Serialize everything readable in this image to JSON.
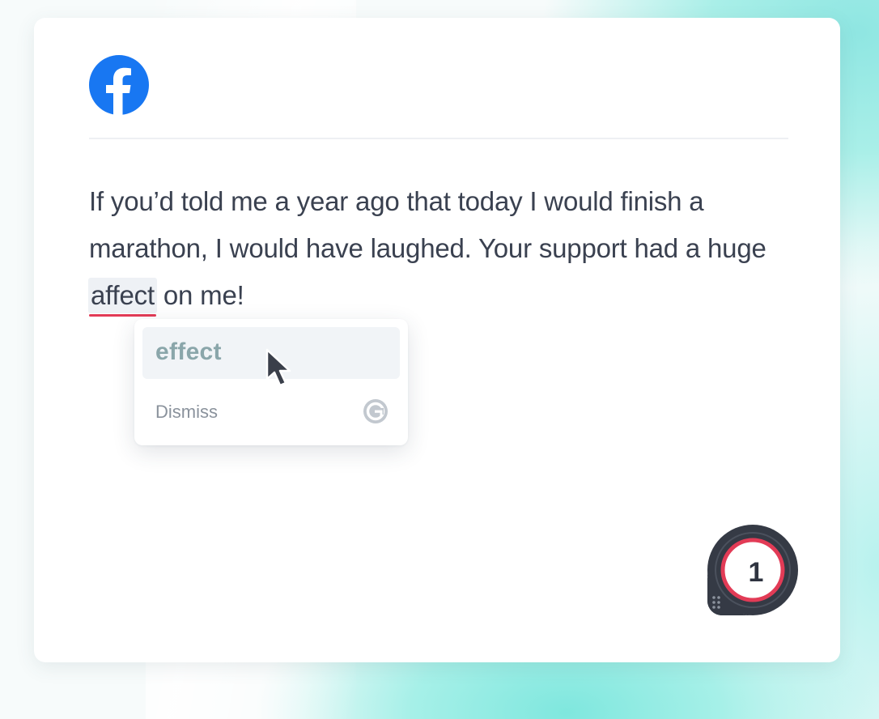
{
  "colors": {
    "facebook_blue": "#1877f2",
    "error_red": "#e23b56",
    "text": "#3a4150",
    "suggestion_text": "#8aa6aa"
  },
  "header": {
    "logo_icon": "facebook-icon"
  },
  "post": {
    "text_before": "If you’d told me a year ago that today I would finish a marathon, I would have laughed. Your support had a huge ",
    "flagged_word": "affect",
    "text_after": " on me!"
  },
  "suggestion": {
    "replacement": "effect",
    "dismiss_label": "Dismiss",
    "brand_icon": "grammarly-g-icon",
    "cursor_icon": "mouse-pointer-icon"
  },
  "badge": {
    "count": "1",
    "icon": "grammarly-badge-icon"
  }
}
